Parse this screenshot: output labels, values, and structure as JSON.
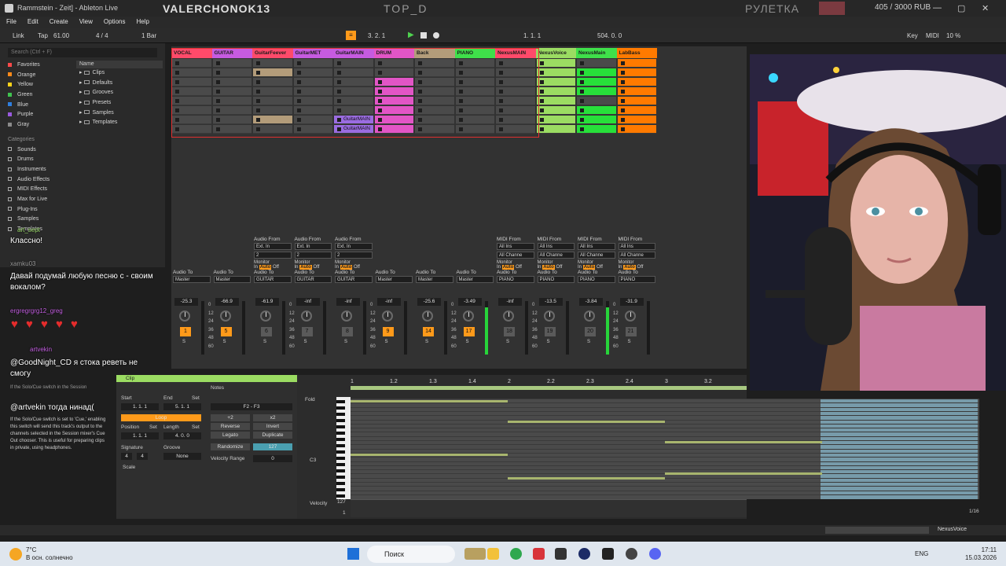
{
  "titlebar": {
    "window_title": "Rammstein - Zeit] - Ableton Live",
    "overlay_name": "VALERCHONOK13",
    "overlay_top": "TOP_D",
    "overlay_roulette": "РУЛЕТКА",
    "overlay_amount": "405 / 3000 RUB"
  },
  "menu": [
    "File",
    "Edit",
    "Create",
    "View",
    "Options",
    "Help"
  ],
  "transport": {
    "link": "Link",
    "tap": "Tap",
    "tempo": "61.00",
    "time_sig": "4 / 4",
    "quant": "1 Bar",
    "position": "3. 2. 1",
    "loop_start": "1. 1. 1",
    "loop_len": "504. 0. 0",
    "key": "Key",
    "midi": "MIDI",
    "cpu": "10 %"
  },
  "browser": {
    "search_placeholder": "Search (Ctrl + F)",
    "favorites_label": "Favorites",
    "tags": [
      {
        "label": "Orange",
        "color": "#ff8a1a"
      },
      {
        "label": "Yellow",
        "color": "#ffd21a"
      },
      {
        "label": "Green",
        "color": "#3fc34f"
      },
      {
        "label": "Blue",
        "color": "#2f7fe0"
      },
      {
        "label": "Purple",
        "color": "#9a5ae0"
      },
      {
        "label": "Gray",
        "color": "#8a8a8a"
      }
    ],
    "categories_label": "Categories",
    "categories": [
      "Sounds",
      "Drums",
      "Instruments",
      "Audio Effects",
      "MIDI Effects",
      "Max for Live",
      "Plug-Ins",
      "Samples",
      "Templates"
    ],
    "name_header": "Name",
    "folders": [
      "Clips",
      "Defaults",
      "Grooves",
      "Presets",
      "Samples",
      "Templates"
    ]
  },
  "tracks": [
    {
      "name": "VOCAL",
      "color": "#ff4a6a",
      "vol": "-25.3",
      "num": "1",
      "num_on": true
    },
    {
      "name": "GUITAR",
      "color": "#c65be0",
      "vol": "-66.9",
      "num": "5",
      "num_on": true
    },
    {
      "name": "GuitarFeever",
      "color": "#ff4a6a",
      "vol": "-61.9",
      "num": "6",
      "num_on": false
    },
    {
      "name": "GuitarMET",
      "color": "#c65be0",
      "vol": "-inf",
      "num": "7",
      "num_on": false
    },
    {
      "name": "GuitarMAIN",
      "color": "#c65be0",
      "vol": "-inf",
      "num": "8",
      "num_on": false
    },
    {
      "name": "DRUM",
      "color": "#e255c6",
      "vol": "-inf",
      "num": "9",
      "num_on": true
    },
    {
      "name": "Back",
      "color": "#b39c7a",
      "vol": "-25.6",
      "num": "14",
      "num_on": true
    },
    {
      "name": "PIANO",
      "color": "#3fe04a",
      "vol": "-3.49",
      "num": "17",
      "num_on": true
    },
    {
      "name": "NexusMAIN",
      "color": "#ff4a6a",
      "vol": "-inf",
      "num": "18",
      "num_on": false
    },
    {
      "name": "NexusVoice",
      "color": "#9bdc62",
      "vol": "-13.5",
      "num": "19",
      "num_on": false
    },
    {
      "name": "NexusMain",
      "color": "#3fe04a",
      "vol": "-3.84",
      "num": "20",
      "num_on": false
    },
    {
      "name": "LabBass",
      "color": "#ff7a00",
      "vol": "-31.9",
      "num": "21",
      "num_on": false
    }
  ],
  "clips": {
    "guitarmain_1": "GuitarMAIN",
    "guitarmain_2": "GuitarMAIN"
  },
  "io": {
    "audio_from": "Audio From",
    "midi_from": "MIDI From",
    "ext_in": "Ext. In",
    "all_ins": "All Ins",
    "all_channels": "All Channe",
    "monitor": "Monitor",
    "in_label": "In",
    "auto_label": "Auto",
    "off_label": "Off",
    "audio_to": "Audio To",
    "master": "Master",
    "guitar_dest": "GUITAR",
    "piano_dest": "PIANO",
    "chan_2": "2"
  },
  "scale_ticks": [
    "0",
    "12",
    "24",
    "36",
    "48",
    "60"
  ],
  "detail": {
    "clip_tab": "Clip",
    "notes_tab": "Notes",
    "start": "Start",
    "end": "End",
    "set": "Set",
    "loop": "Loop",
    "position": "Position",
    "length": "Length",
    "signature": "Signature",
    "groove": "Groove",
    "groove_val": "None",
    "scale": "Scale",
    "note_range": "F2 - F3",
    "plus2": "+2",
    "x2": "x2",
    "reverse": "Reverse",
    "invert": "Invert",
    "legato": "Legato",
    "duplicate": "Duplicate",
    "randomize": "Randomize",
    "rand_val": "127",
    "velocity_range": "Velocity Range",
    "vel_range_val": "0",
    "fold": "Fold",
    "c3": "C3",
    "velocity": "Velocity",
    "vel_top": "127",
    "vel_bot": "1",
    "grid_label": "1/16",
    "start_val": "1. 1. 1",
    "end_val": "5. 1. 1",
    "pos_val": "1. 1. 1",
    "len_val": "4. 0. 0",
    "sig_num": "4",
    "sig_den": "4",
    "ruler": [
      "1",
      "1.2",
      "1.3",
      "1.4",
      "2",
      "2.2",
      "2.3",
      "2.4",
      "3",
      "3.2"
    ]
  },
  "chat": {
    "user1": "art_sept",
    "msg1": "Классно!",
    "user2": "xamku03",
    "msg2": "Давай подумай любую песню с - своим вокалом?",
    "user3": "ergregrgrg12_greg",
    "msg3": "@GoodNight_CD я стока реветь не смогу",
    "user4": "artvekin",
    "msg4": "@artvekin тогда нинад(",
    "info": "If the Solo/Cue switch is set to 'Cue,' enabling this switch will send this track's output to the channels selected in the Session mixer's Cue Out chooser. This is useful for preparing clips in private, using headphones.",
    "info_head": "If the Solo/Cue switch in the Session"
  },
  "status": {
    "track_name": "NexusVoice"
  },
  "taskbar": {
    "temp": "7°C",
    "weather": "В осн. солнечно",
    "search": "Поиск",
    "lang": "ENG",
    "time": "17:11",
    "date": "15.03.2026"
  }
}
